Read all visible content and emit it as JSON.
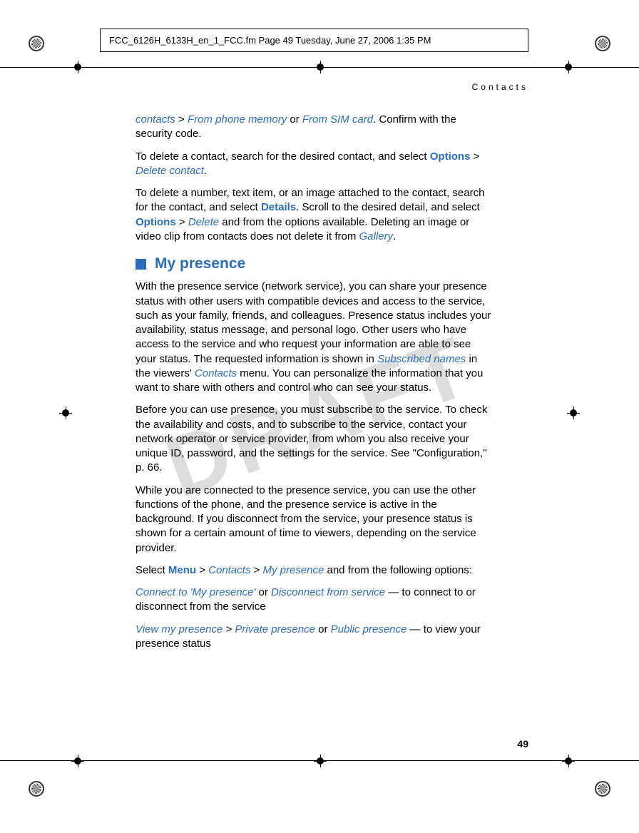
{
  "header_meta": "FCC_6126H_6133H_en_1_FCC.fm  Page 49  Tuesday, June 27, 2006  1:35 PM",
  "running_head": "Contacts",
  "watermark": "DRAFT",
  "page_number": "49",
  "para1": {
    "t1": "contacts",
    "t2": " > ",
    "t3": "From phone memory",
    "t4": " or ",
    "t5": "From SIM card",
    "t6": ". Confirm with the security code."
  },
  "para2": {
    "t1": "To delete a contact, search for the desired contact, and select ",
    "t2": "Options",
    "t3": " > ",
    "t4": "Delete contact",
    "t5": "."
  },
  "para3": {
    "t1": "To delete a number, text item, or an image attached to the contact, search for the contact, and select ",
    "t2": "Details",
    "t3": ". Scroll to the desired detail, and select ",
    "t4": "Options",
    "t5": " > ",
    "t6": "Delete",
    "t7": " and from the options available. Deleting an image or video clip from contacts does not delete it from ",
    "t8": "Gallery",
    "t9": "."
  },
  "heading": "My presence",
  "para4": {
    "t1": "With the presence service (network service), you can share your presence status with other users with compatible devices and access to the service, such as your family, friends, and colleagues. Presence status includes your availability, status message, and personal logo. Other users who have access to the service and who request your information are able to see your status. The requested information is shown in ",
    "t2": "Subscribed names",
    "t3": " in the viewers' ",
    "t4": "Contacts",
    "t5": " menu. You can personalize the information that you want to share with others and control who can see your status."
  },
  "para5": "Before you can use presence, you must subscribe to the service. To check the availability and costs, and to subscribe to the service, contact your network operator or service provider, from whom you also receive your unique ID, password, and the settings for the service. See \"Configuration,\" p. 66.",
  "para6": "While you are connected to the presence service, you can use the other functions of the phone, and the presence service is active in the background. If you disconnect from the service, your presence status is shown for a certain amount of time to viewers, depending on the service provider.",
  "para7": {
    "t1": "Select ",
    "t2": "Menu",
    "t3": " > ",
    "t4": "Contacts",
    "t5": " > ",
    "t6": "My presence",
    "t7": " and from the following options:"
  },
  "para8": {
    "t1": "Connect to 'My presence'",
    "t2": " or ",
    "t3": "Disconnect from service",
    "t4": " — to connect to or disconnect from the service"
  },
  "para9": {
    "t1": "View my presence",
    "t2": " > ",
    "t3": "Private presence",
    "t4": " or ",
    "t5": "Public presence",
    "t6": " — to view your presence status"
  }
}
